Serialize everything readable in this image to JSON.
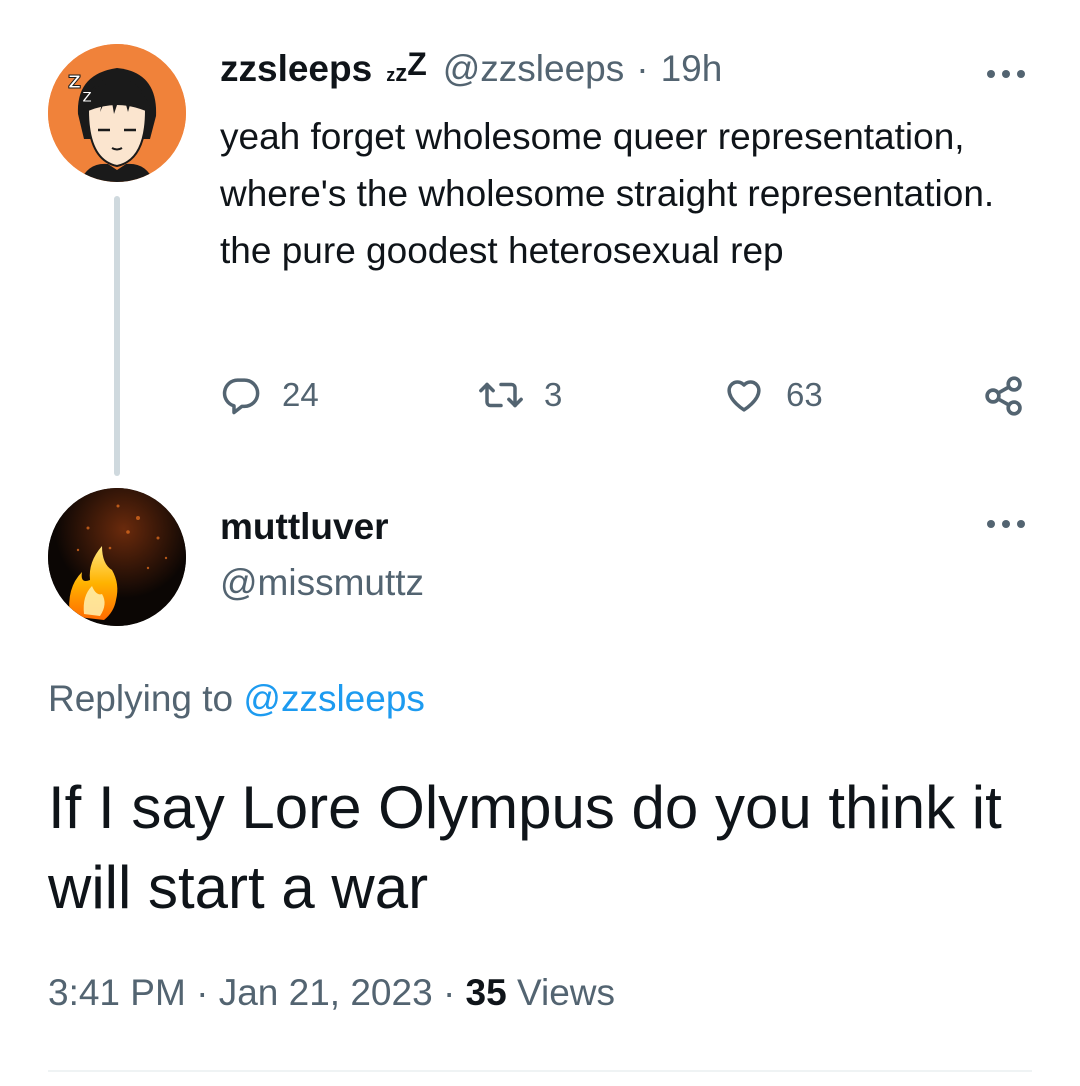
{
  "tweet": {
    "display_name": "zzsleeps",
    "badge_z1": "z",
    "badge_z2": "z",
    "badge_z3": "Z",
    "handle": "@zzsleeps",
    "separator": "·",
    "time": "19h",
    "text": "yeah forget wholesome queer representation, where's the wholesome straight representation. the pure goodest heterosexual rep",
    "actions": {
      "replies": "24",
      "retweets": "3",
      "likes": "63"
    },
    "avatar_icon": "sleeping-cartoon-avatar"
  },
  "reply": {
    "display_name": "muttluver",
    "handle": "@missmuttz",
    "replying_prefix": "Replying to",
    "replying_mention": "@zzsleeps",
    "text": "If I say Lore Olympus do you think it will start a war",
    "time": "3:41 PM",
    "date": "Jan 21, 2023",
    "separator": "·",
    "views_count": "35",
    "views_label": "Views",
    "avatar_icon": "fire-dog-avatar"
  },
  "icons": {
    "reply": "reply-icon",
    "retweet": "retweet-icon",
    "like": "heart-icon",
    "share": "share-icon",
    "more": "more-icon"
  },
  "colors": {
    "text": "#0f1419",
    "secondary": "#536471",
    "link": "#1d9bf0",
    "thread_line": "#cfd9de",
    "avatar_bg": "#f0823a"
  }
}
